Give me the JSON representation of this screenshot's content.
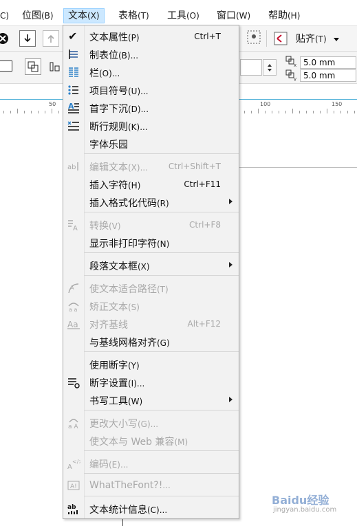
{
  "menubar": {
    "items": [
      {
        "label": "",
        "acc": "C)"
      },
      {
        "label": "位图",
        "acc": "(B)"
      },
      {
        "label": "文本",
        "acc": "(X)"
      },
      {
        "label": "表格",
        "acc": "(T)"
      },
      {
        "label": "工具",
        "acc": "(O)"
      },
      {
        "label": "窗口",
        "acc": "(W)"
      },
      {
        "label": "帮助",
        "acc": "(H)"
      }
    ]
  },
  "toolbar": {
    "snap_label": "贴齐",
    "snap_acc": "(T)",
    "x_value": "5.0 mm",
    "y_value": "5.0 mm"
  },
  "ruler": {
    "labels": [
      "50",
      "100",
      "150"
    ]
  },
  "menu": {
    "items": [
      {
        "label": "文本属性",
        "acc": "(P)",
        "shortcut": "Ctrl+T",
        "checked": true
      },
      {
        "label": "制表位",
        "acc": "(B)...",
        "icon": "tab-stops-icon"
      },
      {
        "label": "栏",
        "acc": "(O)...",
        "icon": "columns-icon"
      },
      {
        "label": "项目符号",
        "acc": "(U)...",
        "icon": "bullets-icon"
      },
      {
        "label": "首字下沉",
        "acc": "(D)...",
        "icon": "drop-cap-icon"
      },
      {
        "label": "断行规则",
        "acc": "(K)...",
        "icon": "line-break-rules-icon"
      },
      {
        "label": "字体乐园",
        "acc": ""
      },
      {
        "label": "编辑文本",
        "acc": "(X)...",
        "shortcut": "Ctrl+Shift+T",
        "disabled": true,
        "icon": "edit-text-icon"
      },
      {
        "label": "插入字符",
        "acc": "(H)",
        "shortcut": "Ctrl+F11"
      },
      {
        "label": "插入格式化代码",
        "acc": "(R)",
        "submenu": true
      },
      {
        "label": "转换",
        "acc": "(V)",
        "shortcut": "Ctrl+F8",
        "disabled": true,
        "icon": "convert-text-icon"
      },
      {
        "label": "显示非打印字符",
        "acc": "(N)"
      },
      {
        "label": "段落文本框",
        "acc": "(X)",
        "submenu": true
      },
      {
        "label": "使文本适合路径",
        "acc": "(T)",
        "disabled": true,
        "icon": "fit-text-to-path-icon"
      },
      {
        "label": "矫正文本",
        "acc": "(S)",
        "disabled": true,
        "icon": "straighten-text-icon"
      },
      {
        "label": "对齐基线",
        "acc": "",
        "shortcut": "Alt+F12",
        "disabled": true,
        "icon": "align-baseline-icon"
      },
      {
        "label": "与基线网格对齐",
        "acc": "(G)"
      },
      {
        "label": "使用断字",
        "acc": "(Y)"
      },
      {
        "label": "断字设置",
        "acc": "(I)...",
        "icon": "hyphenation-settings-icon"
      },
      {
        "label": "书写工具",
        "acc": "(W)",
        "submenu": true
      },
      {
        "label": "更改大小写",
        "acc": "(G)...",
        "disabled": true,
        "icon": "change-case-icon"
      },
      {
        "label": "使文本与 Web 兼容",
        "acc": "(M)",
        "disabled": true
      },
      {
        "label": "编码",
        "acc": "(E)...",
        "disabled": true,
        "icon": "encode-icon"
      },
      {
        "label": "WhatTheFont?!",
        "acc": "...",
        "disabled": true,
        "icon": "whatthefont-icon"
      },
      {
        "label": "文本统计信息",
        "acc": "(C)...",
        "icon": "text-statistics-icon"
      }
    ]
  },
  "watermark": {
    "line1": "Baidu经验",
    "line2": "jingyan.baidu.com"
  }
}
